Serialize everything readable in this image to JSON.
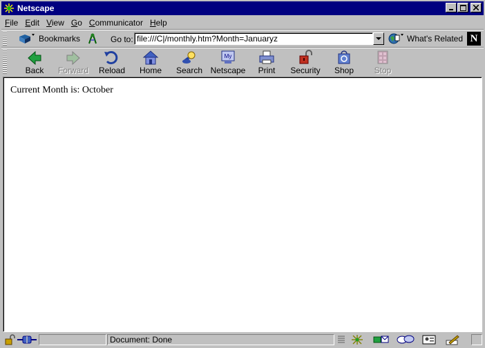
{
  "window": {
    "title": "Netscape"
  },
  "menu": {
    "file": {
      "u": "F",
      "rest": "ile"
    },
    "edit": {
      "u": "E",
      "rest": "dit"
    },
    "view": {
      "u": "V",
      "rest": "iew"
    },
    "go": {
      "u": "G",
      "rest": "o"
    },
    "communicator": {
      "u": "C",
      "rest": "ommunicator"
    },
    "help": {
      "u": "H",
      "rest": "elp"
    }
  },
  "location": {
    "bookmarks_label": "Bookmarks",
    "goto_label": "Go to:",
    "url": "file:///C|/monthly.htm?Month=Januaryz",
    "related_label": "What's Related",
    "logo_letter": "N"
  },
  "toolbar": {
    "back": "Back",
    "forward": "Forward",
    "reload": "Reload",
    "home": "Home",
    "search": "Search",
    "netscape": "Netscape",
    "print": "Print",
    "security": "Security",
    "shop": "Shop",
    "stop": "Stop",
    "my_badge": "My"
  },
  "content": {
    "text": "Current Month is: October"
  },
  "status": {
    "text": "Document: Done"
  },
  "colors": {
    "titlebar": "#000080",
    "chrome": "#c0c0c0",
    "content_bg": "#ffffff"
  }
}
